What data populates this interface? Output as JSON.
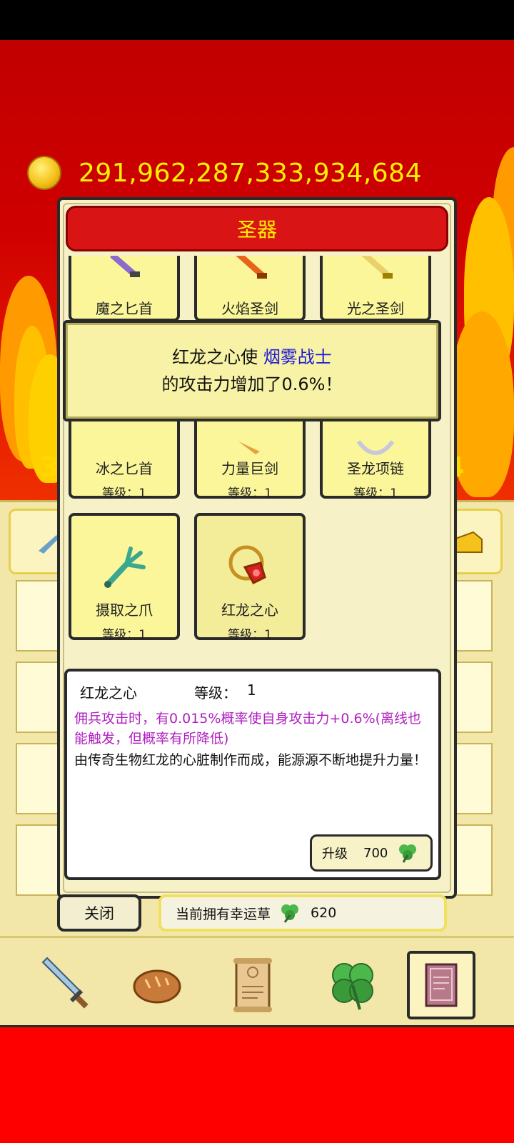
{
  "gold": "291,962,287,333,934,684",
  "side_numbers": {
    "left": "3",
    "right": "4"
  },
  "modal": {
    "title": "圣器",
    "items": [
      {
        "name": "魔之匕首",
        "level": ""
      },
      {
        "name": "火焰圣剑",
        "level": ""
      },
      {
        "name": "光之圣剑",
        "level": ""
      },
      {
        "name": "冰之匕首",
        "level": "等级：1"
      },
      {
        "name": "力量巨剑",
        "level": "等级：1"
      },
      {
        "name": "圣龙项链",
        "level": "等级：1"
      },
      {
        "name": "摄取之爪",
        "level": "等级：1"
      },
      {
        "name": "红龙之心",
        "level": "等级：1"
      }
    ],
    "toast": {
      "prefix": "红龙之心使",
      "target": "烟雾战士",
      "line2": "的攻击力增加了0.6%！"
    },
    "detail": {
      "name": "红龙之心",
      "level_label": "等级：",
      "level_value": "1",
      "effect": "佣兵攻击时，有0.015%概率使自身攻击力+0.6%(离线也能触发，但概率有所降低)",
      "description": "由传奇生物红龙的心脏制作而成，能源源不断地提升力量！",
      "upgrade_label": "升级",
      "upgrade_cost": "700"
    },
    "close_label": "关闭",
    "clover_label": "当前拥有幸运草",
    "clover_count": "620"
  },
  "nav": [
    "sword-icon",
    "bread-icon",
    "scroll-icon",
    "clover-icon",
    "book-icon"
  ],
  "colors": {
    "title_red": "#d81414",
    "gold_text": "#fff200",
    "highlight_blue": "#1a1ad6",
    "effect_purple": "#b020c0"
  }
}
